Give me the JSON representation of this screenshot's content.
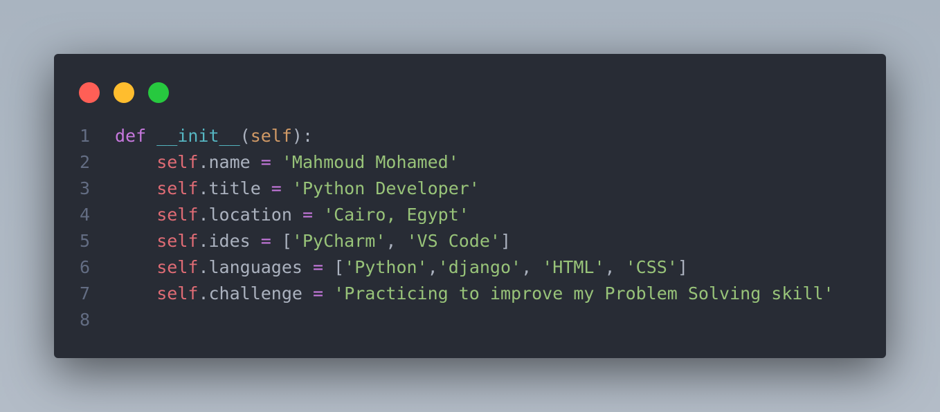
{
  "window": {
    "controls": [
      "close",
      "minimize",
      "maximize"
    ],
    "colors": {
      "background": "#282c35",
      "close": "#ff5f56",
      "minimize": "#ffbd2e",
      "maximize": "#27c93f"
    }
  },
  "code": {
    "language": "python",
    "lines": [
      {
        "number": "1",
        "tokens": [
          {
            "t": "def",
            "c": "kw"
          },
          {
            "t": " ",
            "c": "punc"
          },
          {
            "t": "__init__",
            "c": "fn"
          },
          {
            "t": "(",
            "c": "punc"
          },
          {
            "t": "self",
            "c": "param"
          },
          {
            "t": "):",
            "c": "punc"
          }
        ]
      },
      {
        "number": "2",
        "tokens": [
          {
            "t": "    ",
            "c": "punc"
          },
          {
            "t": "self",
            "c": "self"
          },
          {
            "t": ".name ",
            "c": "attr"
          },
          {
            "t": "=",
            "c": "op"
          },
          {
            "t": " ",
            "c": "punc"
          },
          {
            "t": "'Mahmoud Mohamed'",
            "c": "str"
          }
        ]
      },
      {
        "number": "3",
        "tokens": [
          {
            "t": "    ",
            "c": "punc"
          },
          {
            "t": "self",
            "c": "self"
          },
          {
            "t": ".title ",
            "c": "attr"
          },
          {
            "t": "=",
            "c": "op"
          },
          {
            "t": " ",
            "c": "punc"
          },
          {
            "t": "'Python Developer'",
            "c": "str"
          }
        ]
      },
      {
        "number": "4",
        "tokens": [
          {
            "t": "    ",
            "c": "punc"
          },
          {
            "t": "self",
            "c": "self"
          },
          {
            "t": ".location ",
            "c": "attr"
          },
          {
            "t": "=",
            "c": "op"
          },
          {
            "t": " ",
            "c": "punc"
          },
          {
            "t": "'Cairo, Egypt'",
            "c": "str"
          }
        ]
      },
      {
        "number": "5",
        "tokens": [
          {
            "t": "    ",
            "c": "punc"
          },
          {
            "t": "self",
            "c": "self"
          },
          {
            "t": ".ides ",
            "c": "attr"
          },
          {
            "t": "=",
            "c": "op"
          },
          {
            "t": " [",
            "c": "punc"
          },
          {
            "t": "'PyCharm'",
            "c": "str"
          },
          {
            "t": ", ",
            "c": "punc"
          },
          {
            "t": "'VS Code'",
            "c": "str"
          },
          {
            "t": "]",
            "c": "punc"
          }
        ]
      },
      {
        "number": "6",
        "tokens": [
          {
            "t": "    ",
            "c": "punc"
          },
          {
            "t": "self",
            "c": "self"
          },
          {
            "t": ".languages ",
            "c": "attr"
          },
          {
            "t": "=",
            "c": "op"
          },
          {
            "t": " [",
            "c": "punc"
          },
          {
            "t": "'Python'",
            "c": "str"
          },
          {
            "t": ",",
            "c": "punc"
          },
          {
            "t": "'django'",
            "c": "str"
          },
          {
            "t": ", ",
            "c": "punc"
          },
          {
            "t": "'HTML'",
            "c": "str"
          },
          {
            "t": ", ",
            "c": "punc"
          },
          {
            "t": "'CSS'",
            "c": "str"
          },
          {
            "t": "]",
            "c": "punc"
          }
        ]
      },
      {
        "number": "7",
        "tokens": [
          {
            "t": "    ",
            "c": "punc"
          },
          {
            "t": "self",
            "c": "self"
          },
          {
            "t": ".challenge ",
            "c": "attr"
          },
          {
            "t": "=",
            "c": "op"
          },
          {
            "t": " ",
            "c": "punc"
          },
          {
            "t": "'Practicing to improve my Problem Solving skill'",
            "c": "str"
          }
        ]
      },
      {
        "number": "8",
        "tokens": []
      }
    ]
  }
}
